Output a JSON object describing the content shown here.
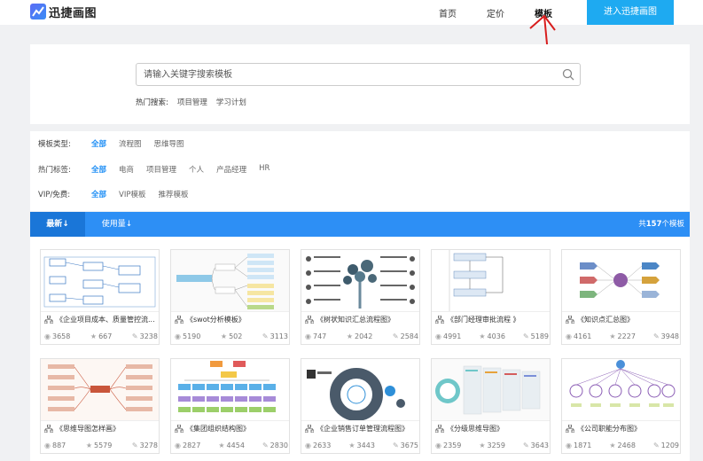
{
  "header": {
    "logo_text": "迅捷画图",
    "nav": [
      "首页",
      "定价",
      "模板"
    ],
    "enter_button": "进入迅捷画图"
  },
  "search": {
    "placeholder": "请输入关键字搜索模板",
    "hot_label": "热门搜索:",
    "hot_items": [
      "项目管理",
      "学习计划"
    ]
  },
  "filters": [
    {
      "label": "模板类型:",
      "options": [
        "全部",
        "流程图",
        "思维导图"
      ],
      "selected": "全部"
    },
    {
      "label": "热门标签:",
      "options": [
        "全部",
        "电商",
        "项目管理",
        "个人",
        "产品经理",
        "HR"
      ],
      "selected": "全部"
    },
    {
      "label": "VIP/免费:",
      "options": [
        "全部",
        "VIP模板",
        "推荐模板"
      ],
      "selected": "全部"
    }
  ],
  "sortbar": {
    "tabs": [
      "最新↓",
      "使用量↓"
    ],
    "active": "最新↓",
    "count_prefix": "共",
    "count": "157",
    "count_suffix": "个模板"
  },
  "colors": {
    "accent": "#2d8ff5",
    "enter_button": "#1eaaf1",
    "selected_filter": "#1e8ef5"
  },
  "cards": [
    {
      "title": "《企业项目成本、质量管控流...",
      "views": "3658",
      "stars": "667",
      "edits": "3238",
      "thumb": "flowchart"
    },
    {
      "title": "《swot分析模板》",
      "views": "5190",
      "stars": "502",
      "edits": "3113",
      "thumb": "mindmap"
    },
    {
      "title": "《树状知识汇总流程图》",
      "views": "747",
      "stars": "2042",
      "edits": "2584",
      "thumb": "tree"
    },
    {
      "title": "《部门经理审批流程 》",
      "views": "4991",
      "stars": "4036",
      "edits": "5189",
      "thumb": "approval"
    },
    {
      "title": "《知识点汇总图》",
      "views": "4161",
      "stars": "2227",
      "edits": "3948",
      "thumb": "hub"
    },
    {
      "title": "《思维导图怎样画》",
      "views": "887",
      "stars": "5579",
      "edits": "3278",
      "thumb": "mindmap2"
    },
    {
      "title": "《集团组织结构图》",
      "views": "2827",
      "stars": "4454",
      "edits": "2830",
      "thumb": "org"
    },
    {
      "title": "《企业销售订单管理流程图》",
      "views": "2633",
      "stars": "3443",
      "edits": "3675",
      "thumb": "ring"
    },
    {
      "title": "《分级思维导图》",
      "views": "2359",
      "stars": "3259",
      "edits": "3643",
      "thumb": "tiers"
    },
    {
      "title": "《公司职能分布图》",
      "views": "1871",
      "stars": "2468",
      "edits": "1209",
      "thumb": "radial"
    }
  ]
}
